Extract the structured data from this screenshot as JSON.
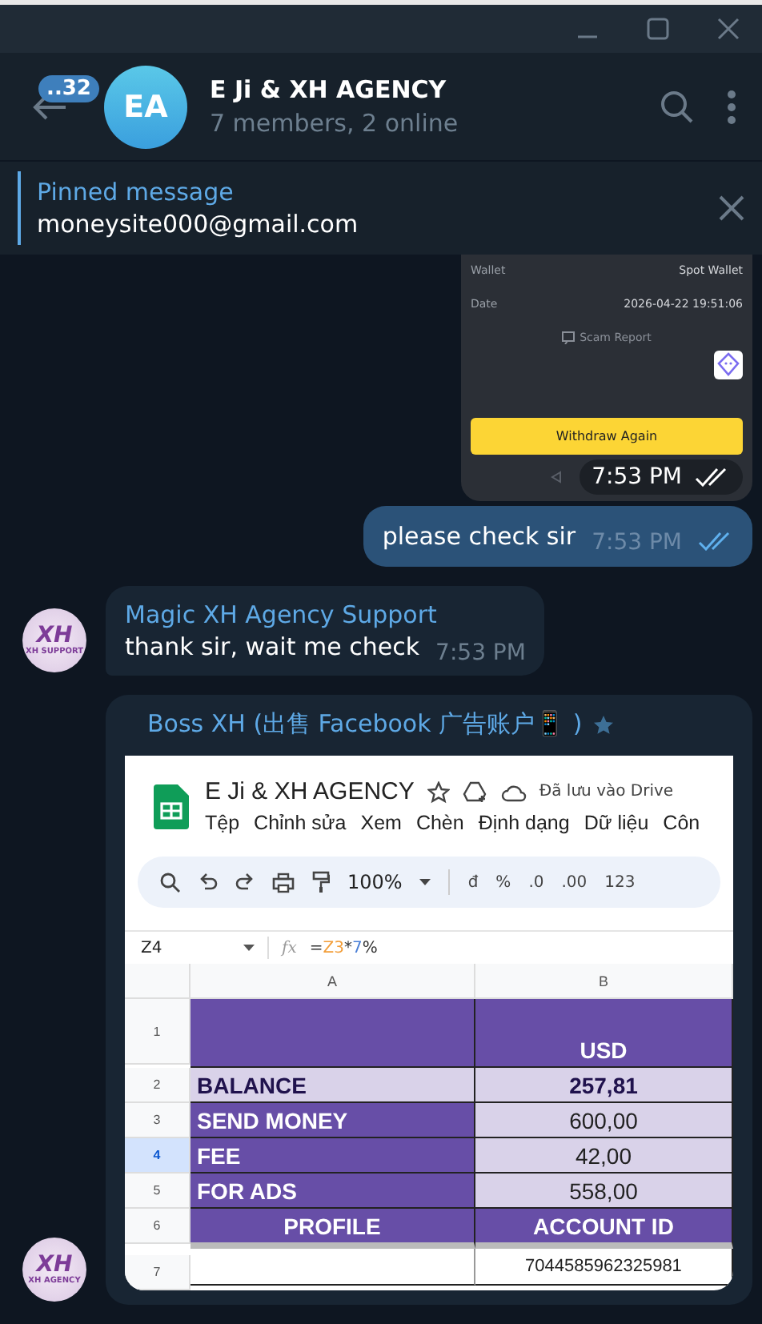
{
  "header": {
    "unread_badge": "..32",
    "avatar_initials": "EA",
    "title": "E Ji & XH AGENCY",
    "subtitle": "7 members, 2 online"
  },
  "pinned": {
    "label": "Pinned message",
    "text": "moneysite000@gmail.com"
  },
  "messages": [
    {
      "kind": "image",
      "outgoing": true,
      "time": "7:53 PM",
      "read": true,
      "image": {
        "rows": [
          {
            "label": "Wallet",
            "value": "Spot Wallet"
          },
          {
            "label": "Date",
            "value": "2026-04-22 19:51:06"
          }
        ],
        "report": "Scam Report",
        "button": "Withdraw Again"
      }
    },
    {
      "kind": "text",
      "outgoing": true,
      "text": "please check sir",
      "time": "7:53 PM",
      "read": true
    },
    {
      "kind": "text",
      "outgoing": false,
      "sender": "Magic XH Agency Support",
      "avatar_logo": "XH",
      "avatar_caption": "XH SUPPORT",
      "text": "thank sir, wait me check",
      "time": "7:53 PM"
    },
    {
      "kind": "sheet",
      "outgoing": false,
      "sender": "Boss XH (出售 Facebook 广告账户📱 )",
      "avatar_logo": "XH",
      "avatar_caption": "XH AGENCY",
      "sheet": {
        "title": "E Ji & XH AGENCY",
        "saved": "Đã lưu vào Drive",
        "menu": [
          "Tệp",
          "Chỉnh sửa",
          "Xem",
          "Chèn",
          "Định dạng",
          "Dữ liệu",
          "Côn"
        ],
        "zoom": "100%",
        "tools": [
          "đ",
          "%",
          ".0",
          ".00",
          "123"
        ],
        "cell_ref": "Z4",
        "formula_icon": "fx",
        "formula": [
          {
            "text": "=",
            "kind": "op"
          },
          {
            "text": "Z3",
            "kind": "ref"
          },
          {
            "text": "*",
            "kind": "op"
          },
          {
            "text": "7",
            "kind": "num"
          },
          {
            "text": "%",
            "kind": "op"
          }
        ],
        "columns": [
          "A",
          "B"
        ],
        "rows": [
          {
            "num": "1",
            "kind": "header",
            "selected": false,
            "col_b": "USD"
          },
          {
            "num": "2",
            "kind": "highlight",
            "selected": false,
            "col_a": "BALANCE",
            "col_b": "257,81"
          },
          {
            "num": "3",
            "kind": "label",
            "selected": false,
            "col_a": "SEND MONEY",
            "col_b": "600,00"
          },
          {
            "num": "4",
            "kind": "label",
            "selected": true,
            "col_a": "FEE",
            "col_b": "42,00"
          },
          {
            "num": "5",
            "kind": "label",
            "selected": false,
            "col_a": "FOR ADS",
            "col_b": "558,00"
          },
          {
            "num": "6",
            "kind": "title",
            "selected": false,
            "col_a": "PROFILE",
            "col_b": "ACCOUNT ID"
          },
          {
            "num": "7",
            "kind": "plain",
            "selected": false,
            "col_b": "7044585962325981"
          }
        ]
      }
    }
  ]
}
